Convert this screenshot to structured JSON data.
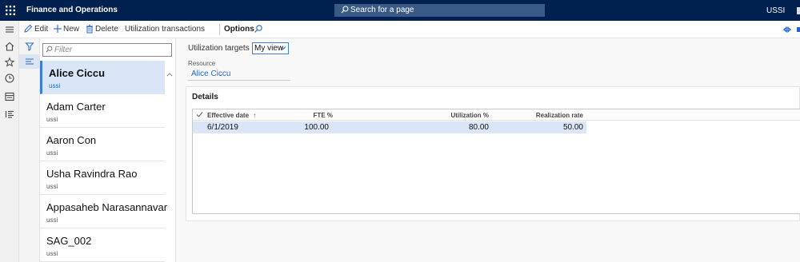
{
  "app": {
    "title": "Finance and Operations",
    "search_placeholder": "Search for a page",
    "company": "USSI"
  },
  "actions": {
    "edit": "Edit",
    "new": "New",
    "delete": "Delete",
    "utilization_transactions": "Utilization transactions",
    "options": "Options"
  },
  "list": {
    "filter_placeholder": "Filter",
    "items": [
      {
        "name": "Alice Ciccu",
        "company": "ussi"
      },
      {
        "name": "Adam Carter",
        "company": "ussi"
      },
      {
        "name": "Aaron Con",
        "company": "ussi"
      },
      {
        "name": "Usha Ravindra Rao",
        "company": "ussi"
      },
      {
        "name": "Appasaheb Narasannavar",
        "company": "ussi"
      },
      {
        "name": "SAG_002",
        "company": "ussi"
      }
    ]
  },
  "main": {
    "breadcrumb": "Utilization targets",
    "breadcrumb_sep": "|",
    "view": "My view",
    "resource_label": "Resource",
    "resource_value": "Alice Ciccu",
    "details_title": "Details",
    "grid": {
      "columns": [
        "Effective date",
        "FTE %",
        "Utilization %",
        "Realization rate"
      ],
      "sort_indicator": "↑",
      "rows": [
        {
          "effective_date": "6/1/2019",
          "fte": "100.00",
          "utilization": "80.00",
          "realization": "50.00"
        }
      ]
    }
  }
}
